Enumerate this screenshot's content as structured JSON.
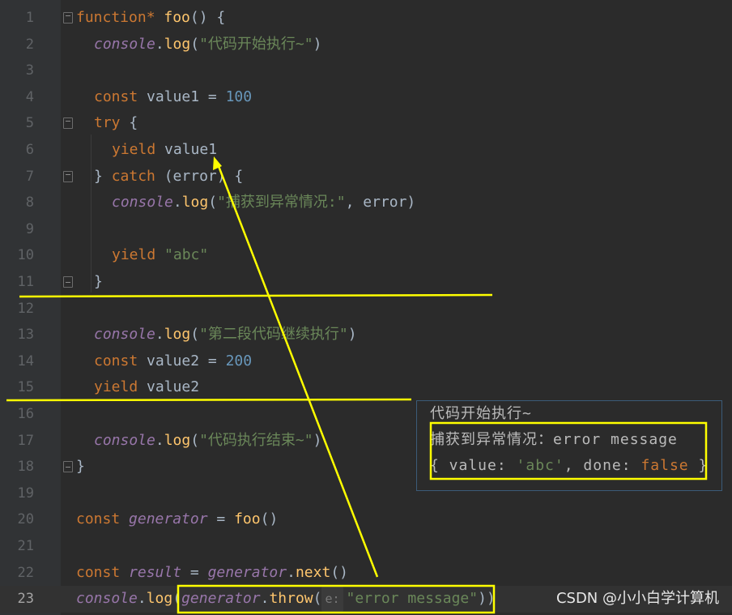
{
  "editor": {
    "lines": [
      {
        "n": "1",
        "indent": 0,
        "fold": "open",
        "tokens": [
          {
            "t": "kw",
            "v": "function* "
          },
          {
            "t": "fn",
            "v": "foo"
          },
          {
            "t": "plain",
            "v": "() {"
          }
        ]
      },
      {
        "n": "2",
        "indent": 1,
        "tokens": [
          {
            "t": "obj",
            "v": "console"
          },
          {
            "t": "plain",
            "v": "."
          },
          {
            "t": "fn",
            "v": "log"
          },
          {
            "t": "plain",
            "v": "("
          },
          {
            "t": "str",
            "v": "\"代码开始执行~\""
          },
          {
            "t": "plain",
            "v": ")"
          }
        ]
      },
      {
        "n": "3",
        "indent": 1,
        "tokens": []
      },
      {
        "n": "4",
        "indent": 1,
        "tokens": [
          {
            "t": "kw",
            "v": "const "
          },
          {
            "t": "plain",
            "v": "value1 = "
          },
          {
            "t": "num",
            "v": "100"
          }
        ]
      },
      {
        "n": "5",
        "indent": 1,
        "fold": "open",
        "tokens": [
          {
            "t": "kw",
            "v": "try "
          },
          {
            "t": "plain",
            "v": "{"
          }
        ]
      },
      {
        "n": "6",
        "indent": 2,
        "tokens": [
          {
            "t": "kw",
            "v": "yield "
          },
          {
            "t": "plain",
            "v": "value1"
          }
        ]
      },
      {
        "n": "7",
        "indent": 1,
        "fold": "open",
        "tokens": [
          {
            "t": "plain",
            "v": "} "
          },
          {
            "t": "kw",
            "v": "catch "
          },
          {
            "t": "plain",
            "v": "(error) {"
          }
        ]
      },
      {
        "n": "8",
        "indent": 2,
        "tokens": [
          {
            "t": "obj",
            "v": "console"
          },
          {
            "t": "plain",
            "v": "."
          },
          {
            "t": "fn",
            "v": "log"
          },
          {
            "t": "plain",
            "v": "("
          },
          {
            "t": "str",
            "v": "\"捕获到异常情况:\""
          },
          {
            "t": "plain",
            "v": ", error)"
          }
        ]
      },
      {
        "n": "9",
        "indent": 2,
        "tokens": []
      },
      {
        "n": "10",
        "indent": 2,
        "tokens": [
          {
            "t": "kw",
            "v": "yield "
          },
          {
            "t": "str",
            "v": "\"abc\""
          }
        ]
      },
      {
        "n": "11",
        "indent": 1,
        "fold": "close",
        "tokens": [
          {
            "t": "plain",
            "v": "}"
          }
        ]
      },
      {
        "n": "12",
        "indent": 0,
        "tokens": []
      },
      {
        "n": "13",
        "indent": 1,
        "tokens": [
          {
            "t": "obj",
            "v": "console"
          },
          {
            "t": "plain",
            "v": "."
          },
          {
            "t": "fn",
            "v": "log"
          },
          {
            "t": "plain",
            "v": "("
          },
          {
            "t": "str",
            "v": "\"第二段代码继续执行\""
          },
          {
            "t": "plain",
            "v": ")"
          }
        ]
      },
      {
        "n": "14",
        "indent": 1,
        "tokens": [
          {
            "t": "kw",
            "v": "const "
          },
          {
            "t": "plain",
            "v": "value2 = "
          },
          {
            "t": "num",
            "v": "200"
          }
        ]
      },
      {
        "n": "15",
        "indent": 1,
        "tokens": [
          {
            "t": "kw",
            "v": "yield "
          },
          {
            "t": "plain",
            "v": "value2"
          }
        ]
      },
      {
        "n": "16",
        "indent": 0,
        "tokens": []
      },
      {
        "n": "17",
        "indent": 1,
        "tokens": [
          {
            "t": "obj",
            "v": "console"
          },
          {
            "t": "plain",
            "v": "."
          },
          {
            "t": "fn",
            "v": "log"
          },
          {
            "t": "plain",
            "v": "("
          },
          {
            "t": "str",
            "v": "\"代码执行结束~\""
          },
          {
            "t": "plain",
            "v": ")"
          }
        ]
      },
      {
        "n": "18",
        "indent": 0,
        "fold": "close",
        "tokens": [
          {
            "t": "plain",
            "v": "}"
          }
        ]
      },
      {
        "n": "19",
        "indent": 0,
        "tokens": []
      },
      {
        "n": "20",
        "indent": 0,
        "tokens": [
          {
            "t": "kw",
            "v": "const "
          },
          {
            "t": "var",
            "v": "generator"
          },
          {
            "t": "plain",
            "v": " = "
          },
          {
            "t": "fn",
            "v": "foo"
          },
          {
            "t": "plain",
            "v": "()"
          }
        ]
      },
      {
        "n": "21",
        "indent": 0,
        "tokens": []
      },
      {
        "n": "22",
        "indent": 0,
        "tokens": [
          {
            "t": "kw",
            "v": "const "
          },
          {
            "t": "var",
            "v": "result"
          },
          {
            "t": "plain",
            "v": " = "
          },
          {
            "t": "var",
            "v": "generator"
          },
          {
            "t": "plain",
            "v": "."
          },
          {
            "t": "fn",
            "v": "next"
          },
          {
            "t": "plain",
            "v": "()"
          }
        ]
      },
      {
        "n": "23",
        "indent": 0,
        "current": true,
        "tokens": [
          {
            "t": "obj",
            "v": "console"
          },
          {
            "t": "plain",
            "v": "."
          },
          {
            "t": "fn",
            "v": "log"
          },
          {
            "t": "plain",
            "v": "("
          },
          {
            "t": "var",
            "v": "generator"
          },
          {
            "t": "plain",
            "v": "."
          },
          {
            "t": "fn",
            "v": "throw"
          },
          {
            "t": "plain",
            "v": "("
          },
          {
            "t": "hint",
            "v": "e:"
          },
          {
            "t": "str",
            "v": "\"error message\""
          },
          {
            "t": "plain",
            "v": "))"
          }
        ]
      }
    ]
  },
  "console": {
    "line1": "代码开始执行~",
    "line2_label": "捕获到异常情况：",
    "line2_value": "error message",
    "line3_prefix": "{ value: ",
    "line3_value": "'abc'",
    "line3_mid": ", done: ",
    "line3_done": "false",
    "line3_suffix": " }"
  },
  "watermark": "CSDN @小小白学计算机",
  "colors": {
    "annotation": "#ffff00",
    "keyword": "#cc7832",
    "function": "#ffc66d",
    "string": "#6a8759",
    "number": "#6897bb",
    "italic_var": "#9876aa"
  }
}
